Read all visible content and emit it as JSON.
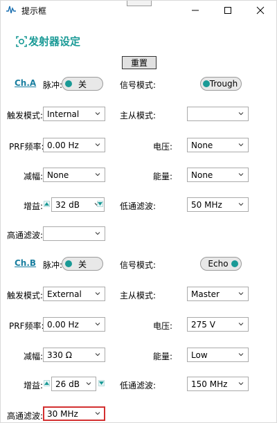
{
  "window": {
    "title": "提示框",
    "minimize_icon": "minimize-icon",
    "maximize_icon": "maximize-icon",
    "close_icon": "close-icon"
  },
  "header": {
    "icon": "radar-target-icon",
    "title": "发射器设定",
    "reset_label": "重置"
  },
  "colors": {
    "accent": "#1a9a96",
    "channel": "#1a7fa0",
    "highlight": "#d32f2f"
  },
  "labels": {
    "pulse": "脉冲:",
    "signal_mode": "信号模式:",
    "trigger_mode": "触发模式:",
    "master_slave": "主从模式:",
    "prf": "PRF频率:",
    "voltage": "电压:",
    "attenuation": "减幅:",
    "energy": "能量:",
    "gain": "增益:",
    "lowpass": "低通滤波:",
    "highpass": "高通滤波:"
  },
  "channel_a": {
    "name": "Ch.A",
    "pulse": "关",
    "signal_mode": "Trough",
    "trigger_mode": "Internal",
    "master_slave": "",
    "prf": "0.00 Hz",
    "voltage": "None",
    "attenuation": "None",
    "energy": "None",
    "gain": "32 dB",
    "lowpass": "50 MHz",
    "highpass": ""
  },
  "channel_b": {
    "name": "Ch.B",
    "pulse": "关",
    "signal_mode": "Echo",
    "trigger_mode": "External",
    "master_slave": "Master",
    "prf": "0.00 Hz",
    "voltage": "275 V",
    "attenuation": "330 Ω",
    "energy": "Low",
    "gain": "26 dB",
    "lowpass": "150 MHz",
    "highpass": "30 MHz"
  }
}
